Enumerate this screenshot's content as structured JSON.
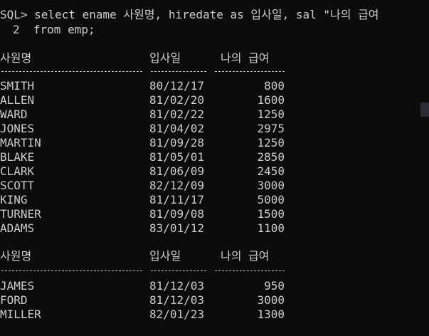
{
  "terminal": {
    "command_line1": "SQL> select ename 사원명, hiredate as 입사일, sal \"나의 급여",
    "command_line2": "2  from emp;"
  },
  "headers": {
    "name": "사원명",
    "date": "입사일",
    "salary": "나의 급여"
  },
  "block1": [
    {
      "name": "SMITH",
      "date": "80/12/17",
      "sal": "800"
    },
    {
      "name": "ALLEN",
      "date": "81/02/20",
      "sal": "1600"
    },
    {
      "name": "WARD",
      "date": "81/02/22",
      "sal": "1250"
    },
    {
      "name": "JONES",
      "date": "81/04/02",
      "sal": "2975"
    },
    {
      "name": "MARTIN",
      "date": "81/09/28",
      "sal": "1250"
    },
    {
      "name": "BLAKE",
      "date": "81/05/01",
      "sal": "2850"
    },
    {
      "name": "CLARK",
      "date": "81/06/09",
      "sal": "2450"
    },
    {
      "name": "SCOTT",
      "date": "82/12/09",
      "sal": "3000"
    },
    {
      "name": "KING",
      "date": "81/11/17",
      "sal": "5000"
    },
    {
      "name": "TURNER",
      "date": "81/09/08",
      "sal": "1500"
    },
    {
      "name": "ADAMS",
      "date": "83/01/12",
      "sal": "1100"
    }
  ],
  "block2": [
    {
      "name": "JAMES",
      "date": "81/12/03",
      "sal": "950"
    },
    {
      "name": "FORD",
      "date": "81/12/03",
      "sal": "3000"
    },
    {
      "name": "MILLER",
      "date": "82/01/23",
      "sal": "1300"
    }
  ]
}
